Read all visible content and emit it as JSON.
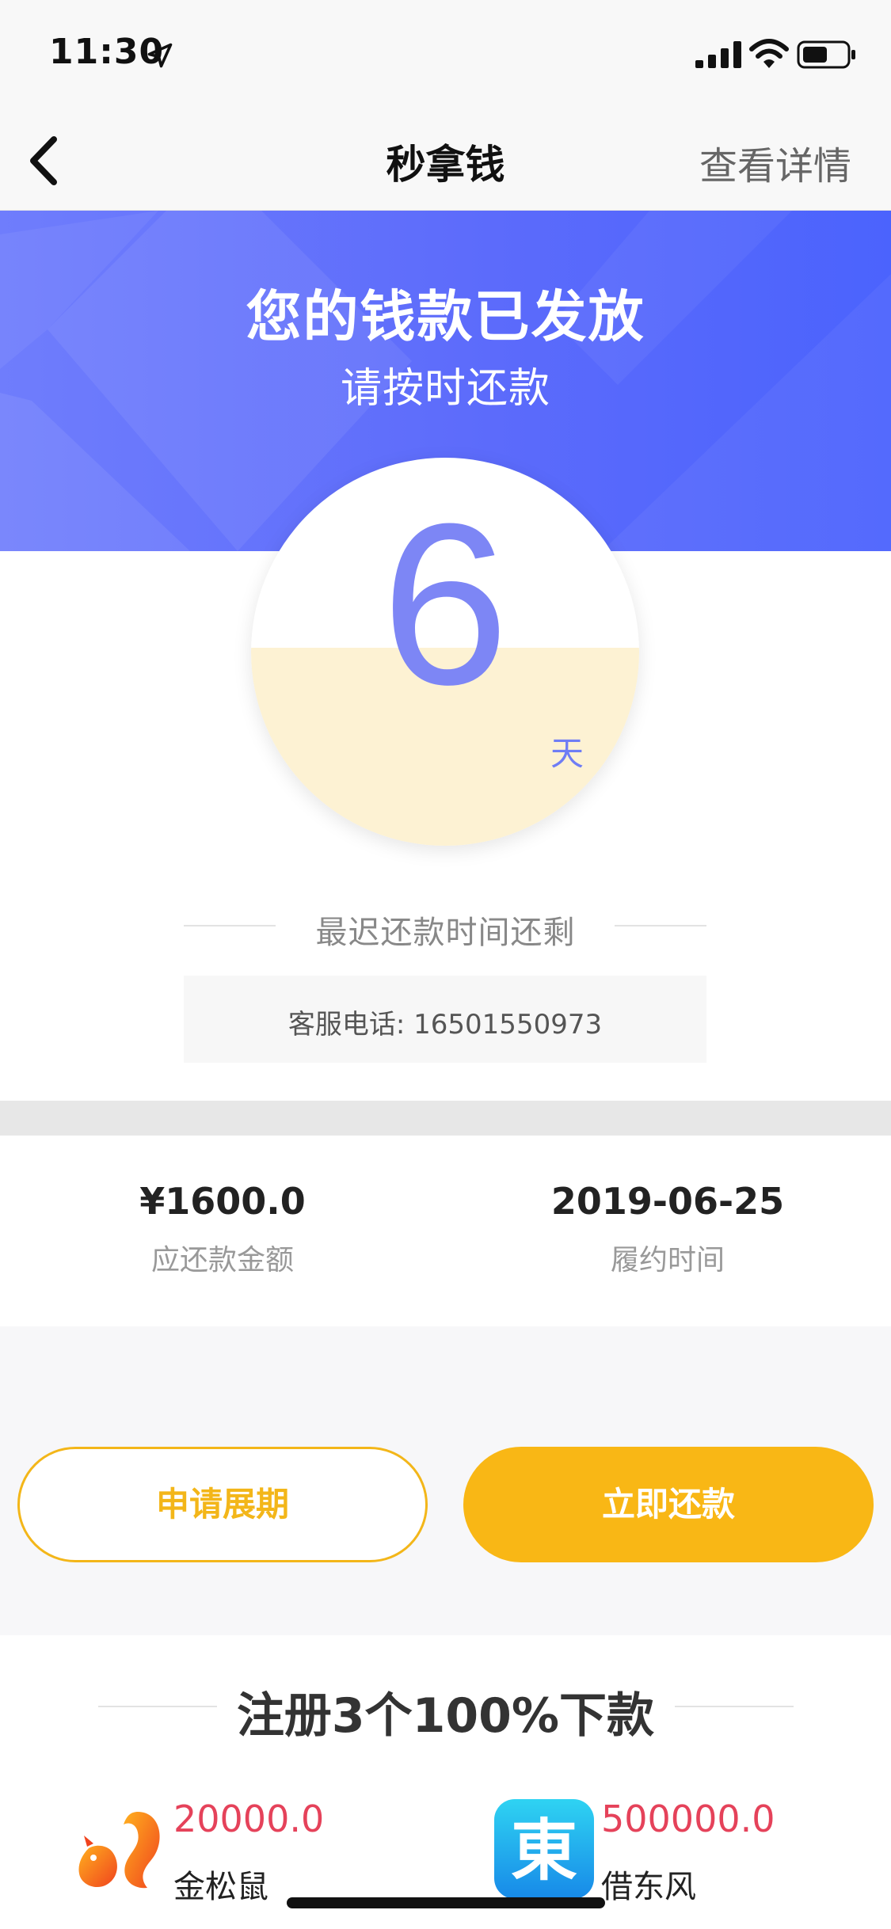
{
  "status_bar": {
    "time": "11:30"
  },
  "nav": {
    "title": "秒拿钱",
    "detail_link": "查看详情"
  },
  "hero": {
    "title": "您的钱款已发放",
    "subtitle": "请按时还款"
  },
  "countdown": {
    "days": "6",
    "unit": "天",
    "caption": "最迟还款时间还剩"
  },
  "service": {
    "phone_text": "客服电话: 16501550973"
  },
  "loan": {
    "amount_value": "¥1600.0",
    "amount_label": "应还款金额",
    "due_value": "2019-06-25",
    "due_label": "履约时间"
  },
  "actions": {
    "extend_label": "申请展期",
    "repay_label": "立即还款"
  },
  "promo": {
    "title": "注册3个100%下款",
    "apps": [
      {
        "amount": "20000.0",
        "name": "金松鼠",
        "logo_text": ""
      },
      {
        "amount": "500000.0",
        "name": "借东风",
        "logo_text": "東"
      }
    ]
  },
  "colors": {
    "primary_blue": "#5c6bfb",
    "accent_orange": "#f9b715",
    "amount_red": "#e5425a"
  }
}
